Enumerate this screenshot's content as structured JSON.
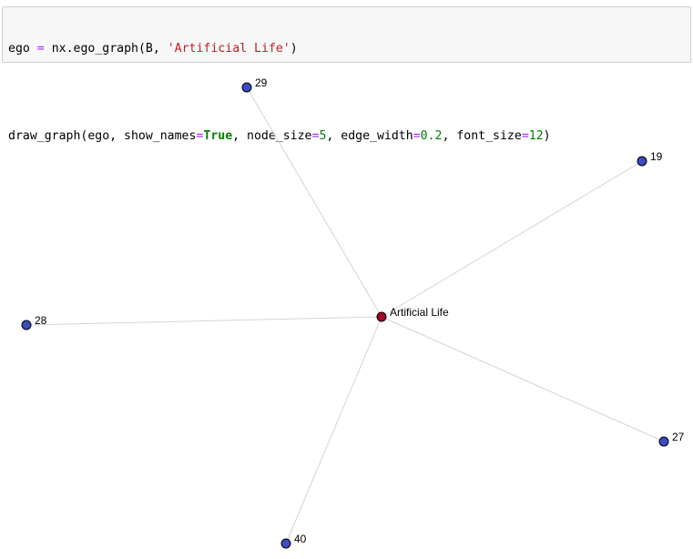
{
  "code_cell": {
    "line1": {
      "var": "ego",
      "op": "=",
      "call": "nx.ego_graph(B, ",
      "str": "'Artificial Life'",
      "close": ")"
    },
    "line2": {
      "call": "draw_graph(ego, show_names",
      "eq1": "=",
      "kw_true": "True",
      "part2": ", node_size",
      "eq2": "=",
      "num1": "5",
      "part3": ", edge_width",
      "eq3": "=",
      "num2": "0.2",
      "part4": ", font_size",
      "eq4": "=",
      "num3": "12",
      "close": ")"
    }
  },
  "graph": {
    "center": {
      "id": "artificial-life",
      "label": "Artificial Life",
      "color": "#a50026"
    },
    "leaf_color": "#3a4cc0",
    "edge_color": "#d4d4d4",
    "nodes": [
      {
        "id": "n29",
        "label": "29"
      },
      {
        "id": "n19",
        "label": "19"
      },
      {
        "id": "n28",
        "label": "28"
      },
      {
        "id": "n27",
        "label": "27"
      },
      {
        "id": "n40",
        "label": "40"
      }
    ]
  }
}
